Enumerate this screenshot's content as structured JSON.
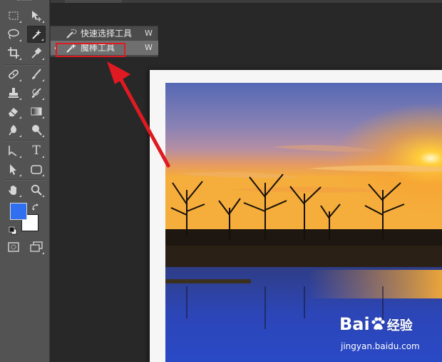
{
  "toolbar": {
    "tools": [
      {
        "name": "rectangular-marquee"
      },
      {
        "name": "move"
      },
      {
        "name": "lasso"
      },
      {
        "name": "magic-wand"
      },
      {
        "name": "crop"
      },
      {
        "name": "eyedropper"
      },
      {
        "name": "spot-healing-brush"
      },
      {
        "name": "brush"
      },
      {
        "name": "clone-stamp"
      },
      {
        "name": "history-brush"
      },
      {
        "name": "eraser"
      },
      {
        "name": "gradient"
      },
      {
        "name": "blur"
      },
      {
        "name": "dodge"
      },
      {
        "name": "pen"
      },
      {
        "name": "type"
      },
      {
        "name": "path-selection"
      },
      {
        "name": "rounded-rectangle"
      },
      {
        "name": "hand"
      },
      {
        "name": "zoom"
      }
    ],
    "type_tool_glyph": "T",
    "foreground_color": "#2f6ff0",
    "background_color": "#ffffff"
  },
  "flyout": {
    "items": [
      {
        "label": "快速选择工具",
        "shortcut": "W",
        "icon": "quick-selection-icon"
      },
      {
        "label": "魔棒工具",
        "shortcut": "W",
        "icon": "magic-wand-icon",
        "selected": true
      }
    ]
  },
  "annotation": {
    "highlight_color": "#e01a22",
    "arrow_color": "#e01a22"
  },
  "watermark": {
    "brand_prefix": "Bai",
    "brand_suffix": "经验",
    "url": "jingyan.baidu.com"
  }
}
